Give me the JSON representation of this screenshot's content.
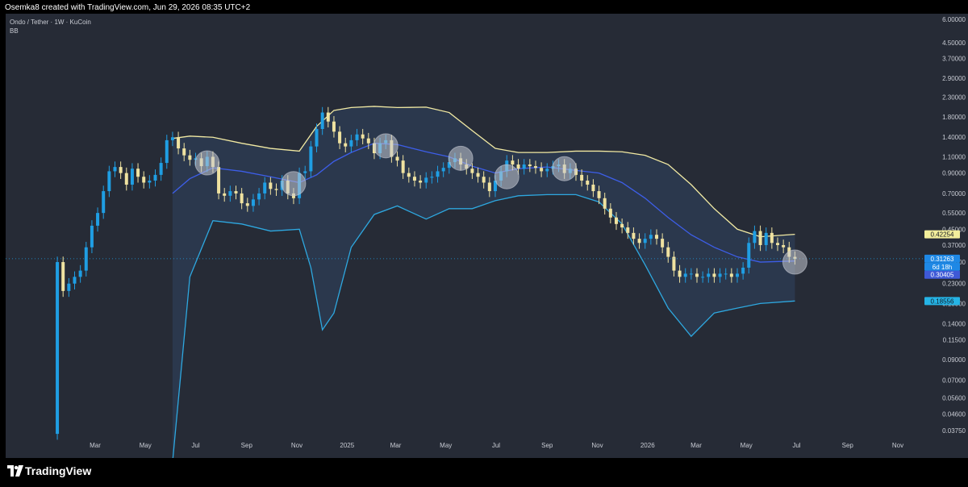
{
  "header": {
    "attribution": "Osemka8 created with TradingView.com, Jun 29, 2026 08:35 UTC+2"
  },
  "legend": {
    "symbol": "Ondo / Tether · 1W · KuCoin",
    "indicator": "BB"
  },
  "branding": {
    "name": "TradingView"
  },
  "colors": {
    "upper_band": "#f2eaa3",
    "basis": "#3d5ee8",
    "lower_band": "#2ea8e0",
    "band_fill": "#2e3d56",
    "candle_up": "#1f9ee3",
    "candle_down": "#efe2a0",
    "highlight_circle": "#c4c8d2",
    "background": "#262b36"
  },
  "chart_data": {
    "type": "candlestick",
    "title": "",
    "y_scale": "log",
    "y_ticks": [
      "6.00000",
      "4.50000",
      "3.70000",
      "2.90000",
      "2.30000",
      "1.80000",
      "1.40000",
      "1.10000",
      "0.90000",
      "0.70000",
      "0.55000",
      "0.45000",
      "0.37000",
      "0.30000",
      "0.23000",
      "0.18000",
      "0.14000",
      "0.11500",
      "0.09000",
      "0.07000",
      "0.05600",
      "0.04600",
      "0.03750"
    ],
    "x_ticks": [
      {
        "label": "Mar",
        "date": "2024-03-01"
      },
      {
        "label": "May",
        "date": "2024-05-01"
      },
      {
        "label": "Jul",
        "date": "2024-07-01"
      },
      {
        "label": "Sep",
        "date": "2024-09-01"
      },
      {
        "label": "Nov",
        "date": "2024-11-01"
      },
      {
        "label": "2025",
        "date": "2025-01-01"
      },
      {
        "label": "Mar",
        "date": "2025-03-01"
      },
      {
        "label": "May",
        "date": "2025-05-01"
      },
      {
        "label": "Jul",
        "date": "2025-07-01"
      },
      {
        "label": "Sep",
        "date": "2025-09-01"
      },
      {
        "label": "Nov",
        "date": "2025-11-01"
      },
      {
        "label": "2026",
        "date": "2026-01-01"
      },
      {
        "label": "Mar",
        "date": "2026-03-01"
      },
      {
        "label": "May",
        "date": "2026-05-01"
      },
      {
        "label": "Jul",
        "date": "2026-07-01"
      },
      {
        "label": "Sep",
        "date": "2026-09-01"
      },
      {
        "label": "Nov",
        "date": "2026-11-01"
      }
    ],
    "price_labels": [
      {
        "value": "0.42254",
        "role": "upper_band"
      },
      {
        "value": "0.31263",
        "role": "last_price"
      },
      {
        "value": "6d 18h",
        "role": "countdown"
      },
      {
        "value": "0.30405",
        "role": "basis"
      },
      {
        "value": "0.18556",
        "role": "lower_band"
      }
    ],
    "last_price": 0.31263,
    "candle_anchors": [
      [
        "2024-01-15",
        0.3
      ],
      [
        "2024-01-22",
        0.21
      ],
      [
        "2024-01-29",
        0.23
      ],
      [
        "2024-02-05",
        0.25
      ],
      [
        "2024-02-12",
        0.27
      ],
      [
        "2024-02-19",
        0.36
      ],
      [
        "2024-02-26",
        0.47
      ],
      [
        "2024-03-04",
        0.55
      ],
      [
        "2024-03-11",
        0.72
      ],
      [
        "2024-03-18",
        0.92
      ],
      [
        "2024-03-25",
        0.97
      ],
      [
        "2024-04-01",
        0.9
      ],
      [
        "2024-04-08",
        0.78
      ],
      [
        "2024-04-15",
        0.95
      ],
      [
        "2024-04-22",
        0.86
      ],
      [
        "2024-04-29",
        0.8
      ],
      [
        "2024-05-06",
        0.82
      ],
      [
        "2024-05-13",
        0.88
      ],
      [
        "2024-05-20",
        1.02
      ],
      [
        "2024-05-27",
        1.35
      ],
      [
        "2024-06-03",
        1.4
      ],
      [
        "2024-06-10",
        1.22
      ],
      [
        "2024-06-17",
        1.12
      ],
      [
        "2024-06-24",
        1.06
      ],
      [
        "2024-07-01",
        1.08
      ],
      [
        "2024-07-08",
        0.98
      ],
      [
        "2024-07-15",
        1.1
      ],
      [
        "2024-07-22",
        0.97
      ],
      [
        "2024-07-29",
        0.7
      ],
      [
        "2024-08-05",
        0.68
      ],
      [
        "2024-08-12",
        0.72
      ],
      [
        "2024-08-19",
        0.7
      ],
      [
        "2024-08-26",
        0.62
      ],
      [
        "2024-09-02",
        0.6
      ],
      [
        "2024-09-09",
        0.65
      ],
      [
        "2024-09-16",
        0.7
      ],
      [
        "2024-09-23",
        0.8
      ],
      [
        "2024-09-30",
        0.74
      ],
      [
        "2024-10-07",
        0.73
      ],
      [
        "2024-10-14",
        0.82
      ],
      [
        "2024-10-21",
        0.7
      ],
      [
        "2024-10-28",
        0.66
      ],
      [
        "2024-11-04",
        0.9
      ],
      [
        "2024-11-11",
        0.92
      ],
      [
        "2024-11-18",
        1.25
      ],
      [
        "2024-11-25",
        1.55
      ],
      [
        "2024-12-02",
        1.9
      ],
      [
        "2024-12-09",
        1.7
      ],
      [
        "2024-12-16",
        1.5
      ],
      [
        "2024-12-23",
        1.3
      ],
      [
        "2024-12-30",
        1.25
      ],
      [
        "2025-01-06",
        1.35
      ],
      [
        "2025-01-13",
        1.45
      ],
      [
        "2025-01-20",
        1.38
      ],
      [
        "2025-01-27",
        1.3
      ],
      [
        "2025-02-03",
        1.15
      ],
      [
        "2025-02-10",
        1.3
      ],
      [
        "2025-02-17",
        1.35
      ],
      [
        "2025-02-24",
        1.1
      ],
      [
        "2025-03-03",
        1.05
      ],
      [
        "2025-03-10",
        0.9
      ],
      [
        "2025-03-17",
        0.86
      ],
      [
        "2025-03-24",
        0.82
      ],
      [
        "2025-03-31",
        0.8
      ],
      [
        "2025-04-07",
        0.85
      ],
      [
        "2025-04-14",
        0.86
      ],
      [
        "2025-04-21",
        0.92
      ],
      [
        "2025-04-28",
        0.96
      ],
      [
        "2025-05-05",
        1.03
      ],
      [
        "2025-05-12",
        1.08
      ],
      [
        "2025-05-19",
        1.0
      ],
      [
        "2025-05-26",
        0.95
      ],
      [
        "2025-06-02",
        0.9
      ],
      [
        "2025-06-09",
        0.86
      ],
      [
        "2025-06-16",
        0.8
      ],
      [
        "2025-06-23",
        0.72
      ],
      [
        "2025-06-30",
        0.82
      ],
      [
        "2025-07-07",
        0.92
      ],
      [
        "2025-07-14",
        1.05
      ],
      [
        "2025-07-21",
        1.0
      ],
      [
        "2025-07-28",
        0.95
      ],
      [
        "2025-08-04",
        1.0
      ],
      [
        "2025-08-11",
        0.98
      ],
      [
        "2025-08-18",
        0.96
      ],
      [
        "2025-08-25",
        0.92
      ],
      [
        "2025-09-01",
        0.95
      ],
      [
        "2025-09-08",
        0.98
      ],
      [
        "2025-09-15",
        1.0
      ],
      [
        "2025-09-22",
        0.9
      ],
      [
        "2025-09-29",
        0.95
      ],
      [
        "2025-10-06",
        0.88
      ],
      [
        "2025-10-13",
        0.82
      ],
      [
        "2025-10-20",
        0.78
      ],
      [
        "2025-10-27",
        0.72
      ],
      [
        "2025-11-03",
        0.66
      ],
      [
        "2025-11-10",
        0.58
      ],
      [
        "2025-11-17",
        0.52
      ],
      [
        "2025-11-24",
        0.48
      ],
      [
        "2025-12-01",
        0.46
      ],
      [
        "2025-12-08",
        0.43
      ],
      [
        "2025-12-15",
        0.4
      ],
      [
        "2025-12-22",
        0.38
      ],
      [
        "2025-12-29",
        0.4
      ],
      [
        "2026-01-05",
        0.42
      ],
      [
        "2026-01-12",
        0.4
      ],
      [
        "2026-01-19",
        0.36
      ],
      [
        "2026-01-26",
        0.32
      ],
      [
        "2026-02-02",
        0.27
      ],
      [
        "2026-02-09",
        0.25
      ],
      [
        "2026-02-16",
        0.26
      ],
      [
        "2026-02-23",
        0.26
      ],
      [
        "2026-03-02",
        0.25
      ],
      [
        "2026-03-09",
        0.25
      ],
      [
        "2026-03-16",
        0.26
      ],
      [
        "2026-03-23",
        0.25
      ],
      [
        "2026-03-30",
        0.26
      ],
      [
        "2026-04-06",
        0.26
      ],
      [
        "2026-04-13",
        0.25
      ],
      [
        "2026-04-20",
        0.26
      ],
      [
        "2026-04-27",
        0.28
      ],
      [
        "2026-05-04",
        0.38
      ],
      [
        "2026-05-11",
        0.44
      ],
      [
        "2026-05-18",
        0.37
      ],
      [
        "2026-05-25",
        0.43
      ],
      [
        "2026-06-01",
        0.38
      ],
      [
        "2026-06-08",
        0.37
      ],
      [
        "2026-06-15",
        0.36
      ],
      [
        "2026-06-22",
        0.32
      ],
      [
        "2026-06-29",
        0.31263
      ]
    ],
    "bollinger_bands": {
      "upper": [
        [
          "2024-06-03",
          1.38
        ],
        [
          "2024-06-24",
          1.42
        ],
        [
          "2024-07-22",
          1.4
        ],
        [
          "2024-08-26",
          1.3
        ],
        [
          "2024-09-30",
          1.22
        ],
        [
          "2024-11-04",
          1.18
        ],
        [
          "2024-11-25",
          1.6
        ],
        [
          "2024-12-16",
          1.95
        ],
        [
          "2025-01-06",
          2.02
        ],
        [
          "2025-02-03",
          2.05
        ],
        [
          "2025-03-03",
          2.02
        ],
        [
          "2025-04-07",
          2.03
        ],
        [
          "2025-05-05",
          1.9
        ],
        [
          "2025-06-02",
          1.52
        ],
        [
          "2025-06-30",
          1.22
        ],
        [
          "2025-07-28",
          1.16
        ],
        [
          "2025-09-01",
          1.16
        ],
        [
          "2025-10-06",
          1.18
        ],
        [
          "2025-11-03",
          1.18
        ],
        [
          "2025-12-01",
          1.17
        ],
        [
          "2025-12-29",
          1.12
        ],
        [
          "2026-01-26",
          1.0
        ],
        [
          "2026-02-23",
          0.78
        ],
        [
          "2026-03-23",
          0.58
        ],
        [
          "2026-04-20",
          0.45
        ],
        [
          "2026-05-18",
          0.41
        ],
        [
          "2026-06-29",
          0.42254
        ]
      ],
      "basis": [
        [
          "2024-06-03",
          0.7
        ],
        [
          "2024-06-24",
          0.84
        ],
        [
          "2024-07-22",
          0.96
        ],
        [
          "2024-08-26",
          0.92
        ],
        [
          "2024-09-30",
          0.86
        ],
        [
          "2024-11-04",
          0.8
        ],
        [
          "2024-11-25",
          0.88
        ],
        [
          "2024-12-16",
          1.04
        ],
        [
          "2025-01-06",
          1.16
        ],
        [
          "2025-02-03",
          1.3
        ],
        [
          "2025-03-03",
          1.28
        ],
        [
          "2025-04-07",
          1.17
        ],
        [
          "2025-05-05",
          1.1
        ],
        [
          "2025-06-02",
          0.98
        ],
        [
          "2025-06-30",
          0.9
        ],
        [
          "2025-07-28",
          0.95
        ],
        [
          "2025-09-01",
          0.97
        ],
        [
          "2025-10-06",
          0.93
        ],
        [
          "2025-11-03",
          0.9
        ],
        [
          "2025-12-01",
          0.8
        ],
        [
          "2025-12-29",
          0.66
        ],
        [
          "2026-01-26",
          0.52
        ],
        [
          "2026-02-23",
          0.42
        ],
        [
          "2026-03-23",
          0.36
        ],
        [
          "2026-04-20",
          0.32
        ],
        [
          "2026-05-18",
          0.3
        ],
        [
          "2026-06-29",
          0.30405
        ]
      ],
      "lower": [
        [
          "2024-06-03",
          0.018
        ],
        [
          "2024-06-24",
          0.25
        ],
        [
          "2024-07-22",
          0.5
        ],
        [
          "2024-08-26",
          0.48
        ],
        [
          "2024-09-30",
          0.44
        ],
        [
          "2024-11-04",
          0.45
        ],
        [
          "2024-11-18",
          0.28
        ],
        [
          "2024-12-02",
          0.13
        ],
        [
          "2024-12-16",
          0.16
        ],
        [
          "2025-01-06",
          0.36
        ],
        [
          "2025-02-03",
          0.54
        ],
        [
          "2025-03-03",
          0.6
        ],
        [
          "2025-04-07",
          0.51
        ],
        [
          "2025-05-05",
          0.58
        ],
        [
          "2025-06-02",
          0.58
        ],
        [
          "2025-06-30",
          0.64
        ],
        [
          "2025-07-28",
          0.68
        ],
        [
          "2025-09-01",
          0.69
        ],
        [
          "2025-10-06",
          0.69
        ],
        [
          "2025-11-03",
          0.63
        ],
        [
          "2025-12-01",
          0.48
        ],
        [
          "2025-12-29",
          0.29
        ],
        [
          "2026-01-26",
          0.17
        ],
        [
          "2026-02-23",
          0.12
        ],
        [
          "2026-03-23",
          0.16
        ],
        [
          "2026-04-20",
          0.17
        ],
        [
          "2026-05-18",
          0.18
        ],
        [
          "2026-06-29",
          0.18556
        ]
      ]
    },
    "highlight_points": [
      [
        "2024-07-15",
        1.02
      ],
      [
        "2024-10-28",
        0.79
      ],
      [
        "2025-02-17",
        1.26
      ],
      [
        "2025-05-19",
        1.08
      ],
      [
        "2025-07-14",
        0.86
      ],
      [
        "2025-09-22",
        0.95
      ],
      [
        "2026-06-29",
        0.3
      ]
    ]
  }
}
